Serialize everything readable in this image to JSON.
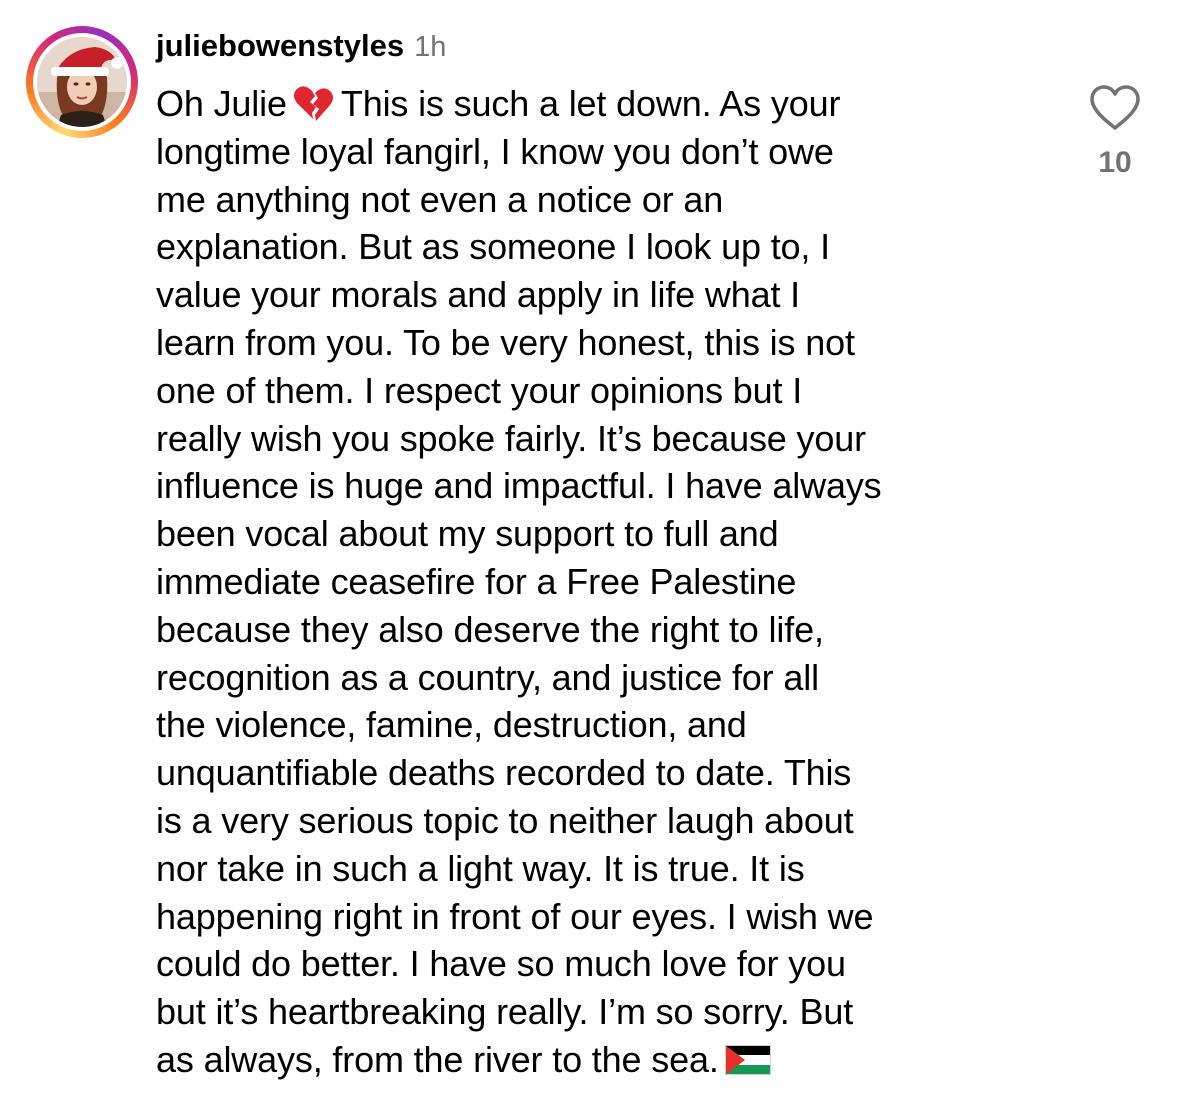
{
  "comment": {
    "username": "juliebowenstyles",
    "timestamp": "1h",
    "avatar_icon": "profile-photo-santa-hat",
    "lines": {
      "l0_pre": "Oh Julie",
      "l0_post": "This is such a let down. As your",
      "l1": "longtime loyal fangirl, I know you don’t owe",
      "l2": "me anything not even a notice or an",
      "l3": "explanation. But as someone I look up to, I",
      "l4": "value your morals and apply in life what I",
      "l5": "learn from you. To be very honest, this is not",
      "l6": "one of them. I respect your opinions but I",
      "l7": "really wish you spoke fairly. It’s because your",
      "l8": "influence is huge and impactful. I have always",
      "l9": "been vocal about my support to full and",
      "l10": "immediate ceasefire for a Free Palestine",
      "l11": "because they also deserve the right to life,",
      "l12": "recognition as a country, and justice for all",
      "l13": "the violence, famine, destruction, and",
      "l14": "unquantifiable deaths recorded to date. This",
      "l15": "is a very serious topic to neither laugh about",
      "l16": "nor take in such a light way. It is true. It is",
      "l17": "happening right in front of our eyes. I wish we",
      "l18": "could do better. I have so much love for you",
      "l19": "but it’s heartbreaking really. I’m so sorry. But",
      "l20": "as always, from the river to the sea."
    },
    "emojis": {
      "broken_heart": "broken-heart-emoji",
      "flag": "palestine-flag-emoji"
    },
    "like": {
      "icon": "heart-outline-icon",
      "count": "10"
    }
  },
  "colors": {
    "text": "#000000",
    "secondary_text": "#737373",
    "story_ring_start": "#feda75",
    "story_ring_mid": "#d62976",
    "story_ring_end": "#962fbf",
    "broken_heart": "#e0262f",
    "flag_black": "#000000",
    "flag_white": "#ffffff",
    "flag_green": "#149954",
    "flag_red": "#e4312b"
  }
}
